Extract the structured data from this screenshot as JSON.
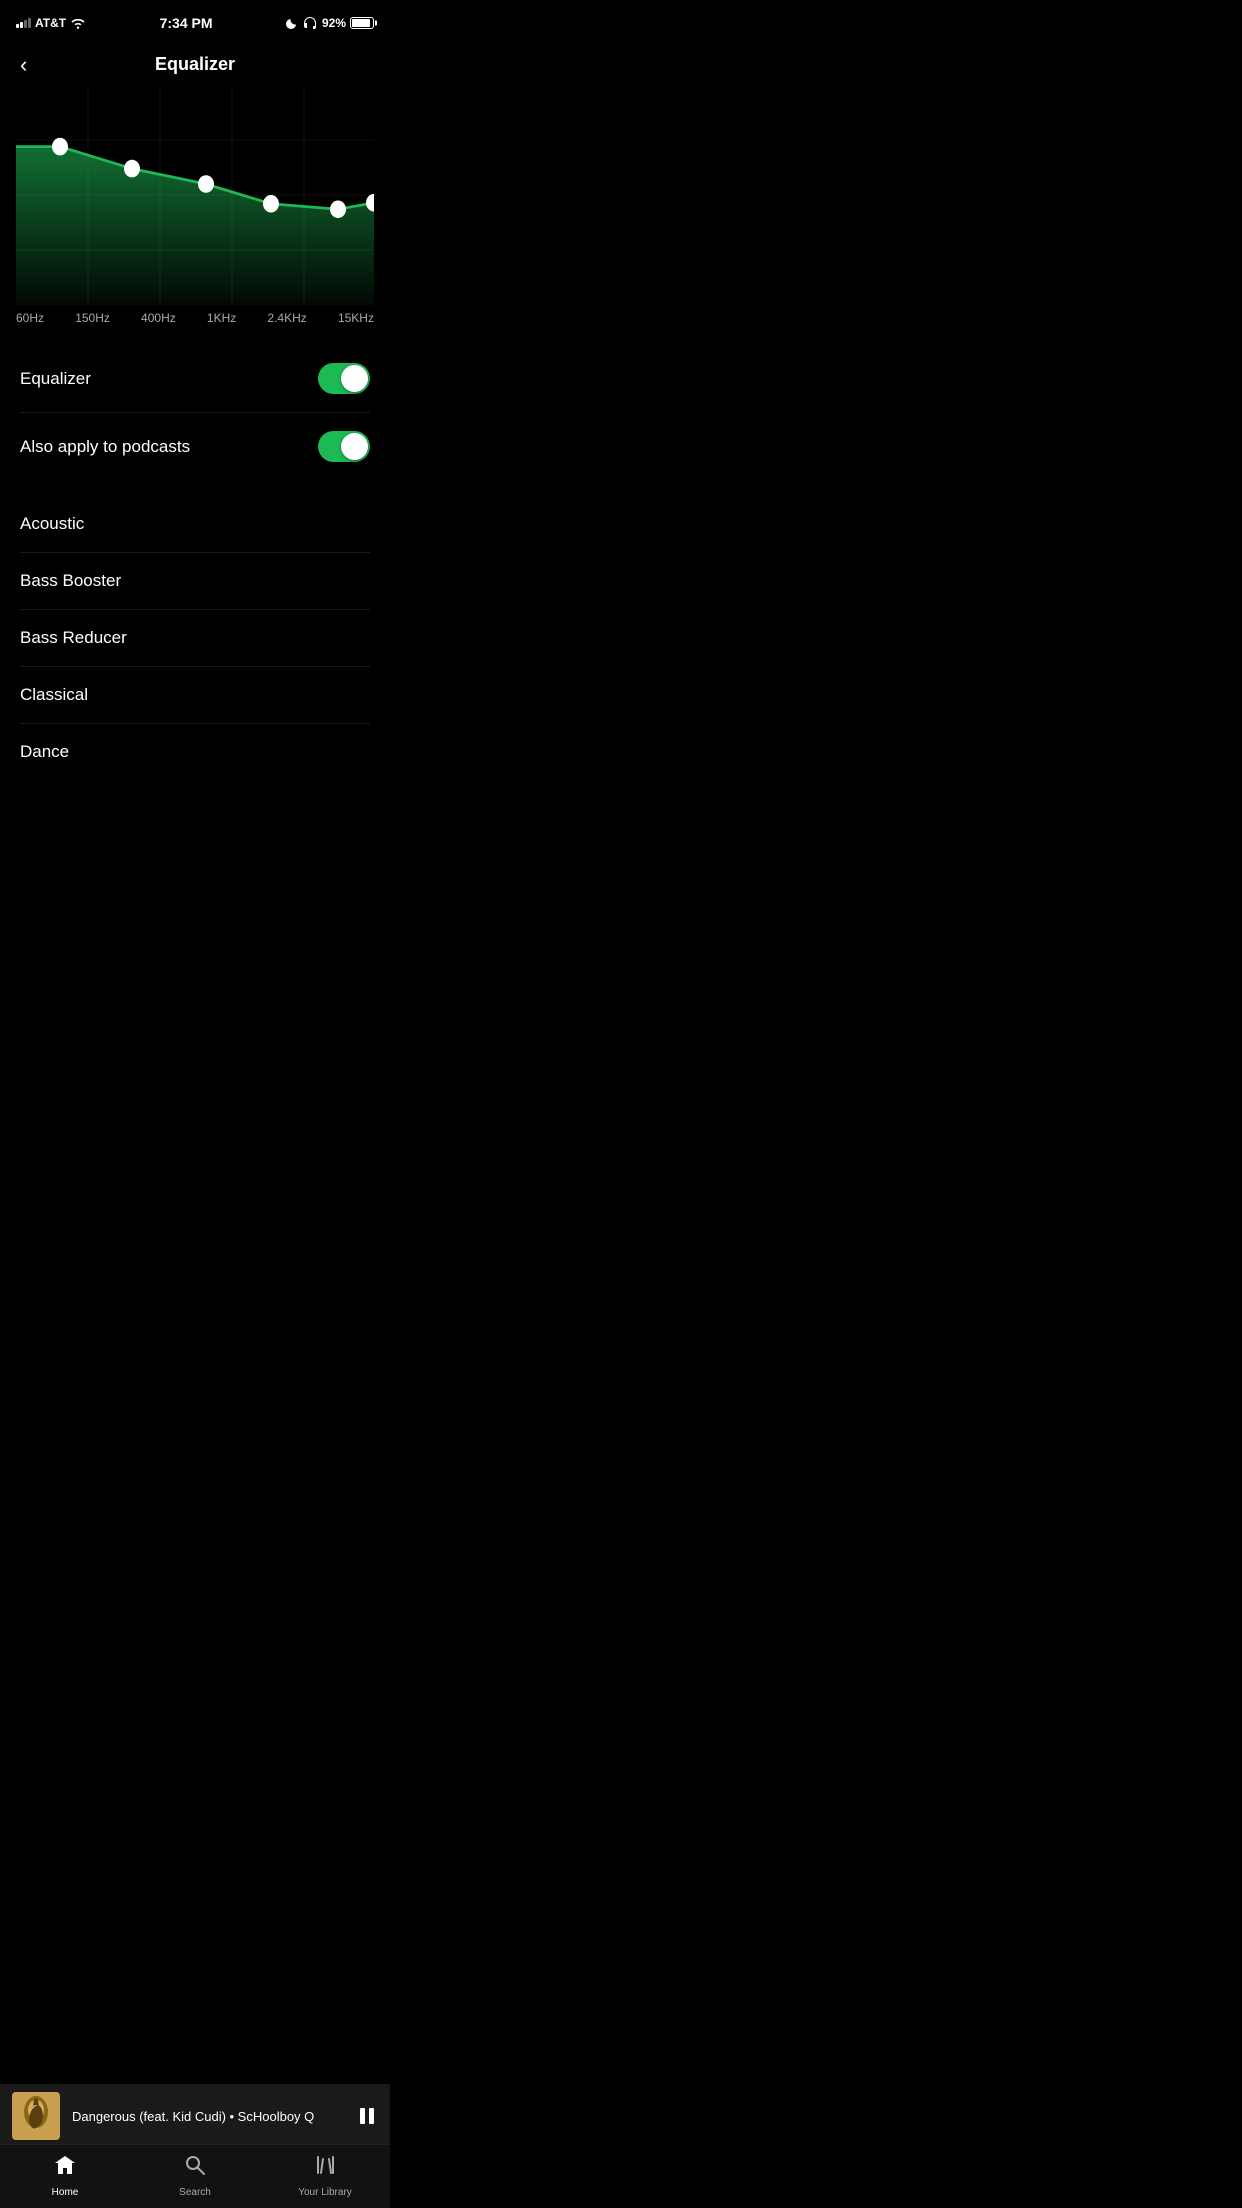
{
  "statusBar": {
    "carrier": "AT&T",
    "time": "7:34 PM",
    "battery": "92%"
  },
  "header": {
    "back_label": "‹",
    "title": "Equalizer"
  },
  "equalizer": {
    "frequencies": [
      "60Hz",
      "150Hz",
      "400Hz",
      "1KHz",
      "2.4KHz",
      "15KHz"
    ],
    "points": [
      {
        "freq": "60Hz",
        "value": 72
      },
      {
        "freq": "150Hz",
        "value": 58
      },
      {
        "freq": "400Hz",
        "value": 47
      },
      {
        "freq": "1KHz",
        "value": 35
      },
      {
        "freq": "2.4KHz",
        "value": 30
      },
      {
        "freq": "15KHz",
        "value": 34
      }
    ]
  },
  "toggles": {
    "equalizer": {
      "label": "Equalizer",
      "enabled": true
    },
    "podcasts": {
      "label": "Also apply to podcasts",
      "enabled": true
    }
  },
  "presets": [
    {
      "label": "Acoustic"
    },
    {
      "label": "Bass Booster"
    },
    {
      "label": "Bass Reducer"
    },
    {
      "label": "Classical"
    },
    {
      "label": "Dance"
    }
  ],
  "miniPlayer": {
    "track": "Dangerous (feat. Kid Cudi)",
    "artist": "ScHoolboy Q",
    "full_text": "Dangerous (feat. Kid Cudi) • ScHoolboy Q"
  },
  "tabBar": {
    "tabs": [
      {
        "label": "Home",
        "active": false
      },
      {
        "label": "Search",
        "active": false
      },
      {
        "label": "Your Library",
        "active": false
      }
    ]
  },
  "colors": {
    "accent": "#1db954",
    "background": "#000000",
    "surface": "#1a1a1a"
  }
}
